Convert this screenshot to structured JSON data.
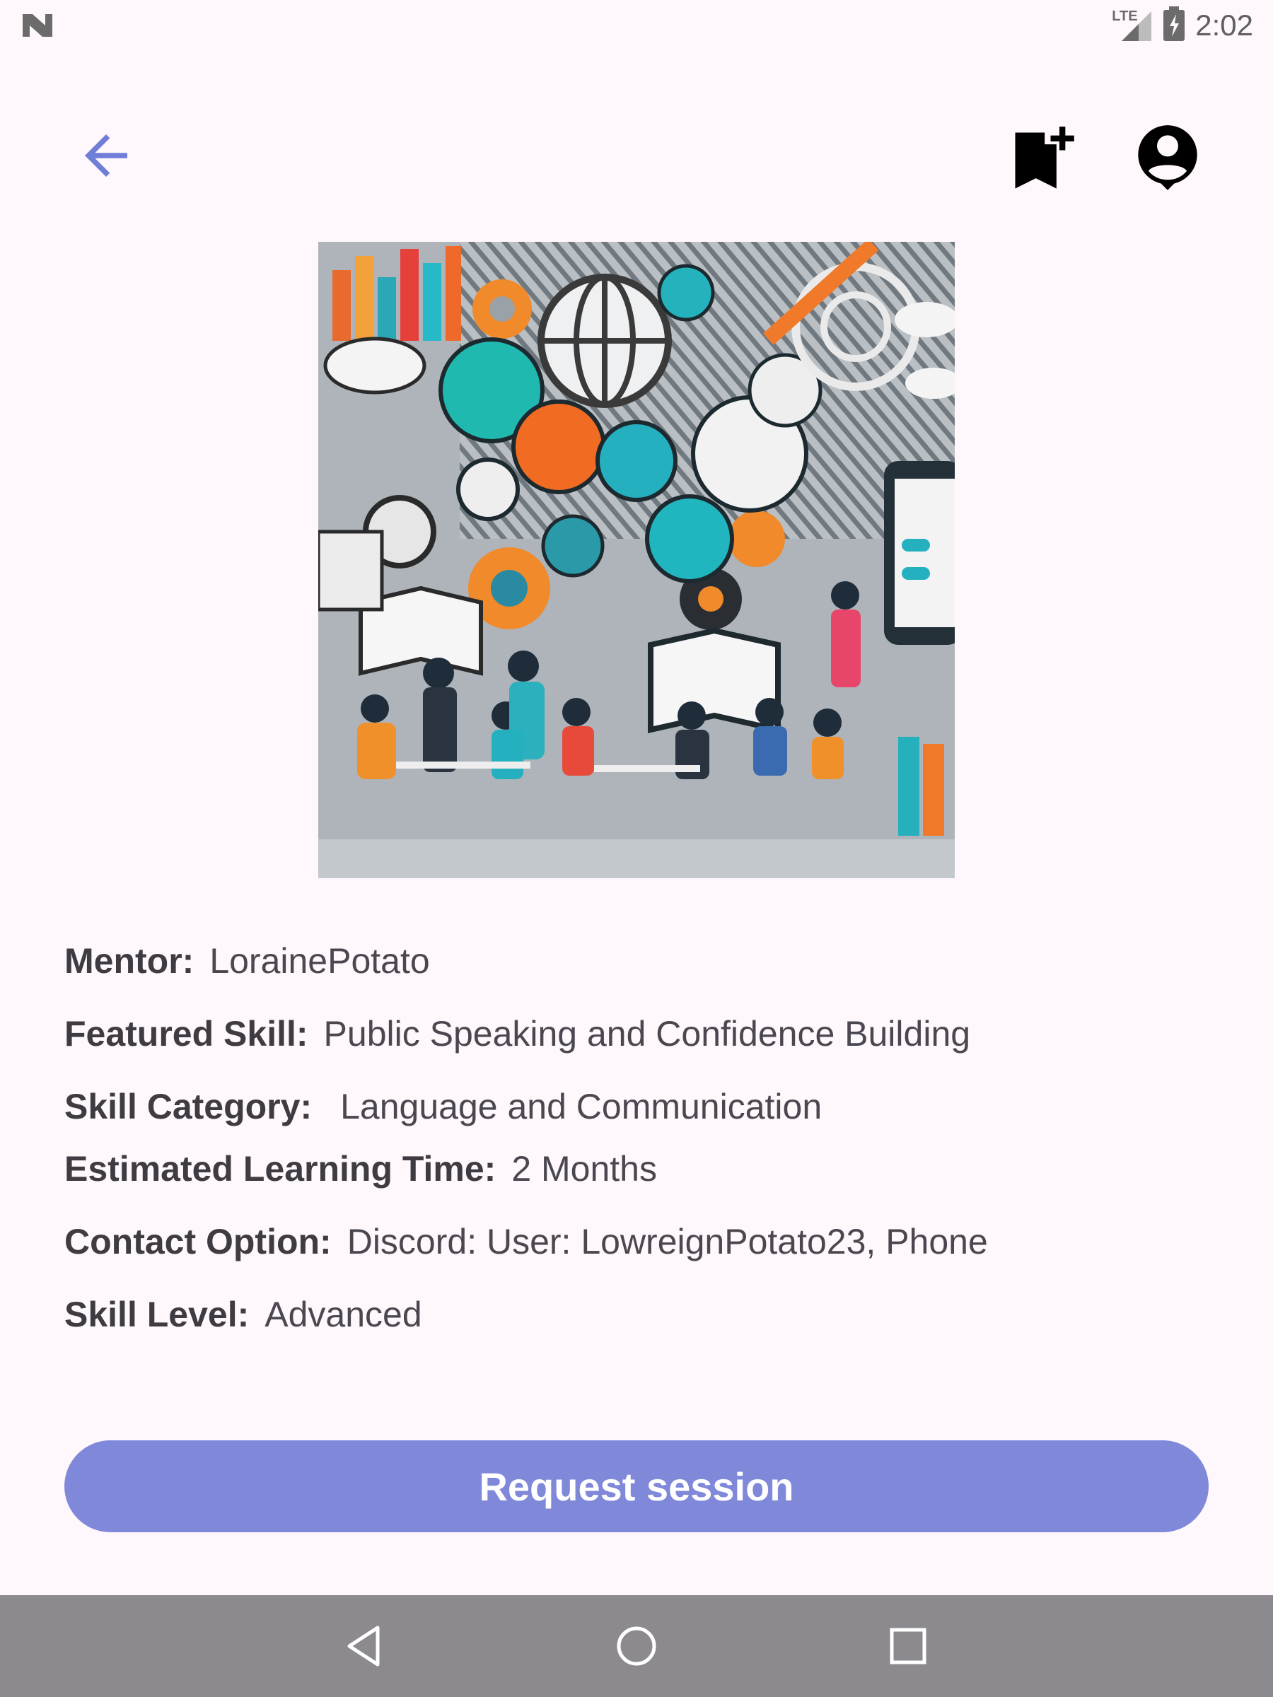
{
  "status_bar": {
    "time": "2:02",
    "network_label": "LTE",
    "icons": [
      "notification-n-icon",
      "signal-icon",
      "battery-charging-icon"
    ]
  },
  "top_bar": {
    "icons": [
      "arrow-back-icon",
      "bookmark-add-icon",
      "account-circle-icon"
    ],
    "accent_color": "#6f7ed6"
  },
  "hero_image": {
    "description_icon": "skill-illustration-image"
  },
  "details": {
    "mentor": {
      "label": "Mentor:",
      "value": "LorainePotato"
    },
    "featured_skill": {
      "label": "Featured Skill:",
      "value": "Public Speaking and Confidence Building"
    },
    "skill_category": {
      "label": "Skill Category:",
      "value": "Language and Communication"
    },
    "learning_time": {
      "label": "Estimated Learning Time:",
      "value": "2 Months"
    },
    "contact_option": {
      "label": "Contact Option:",
      "value": "Discord: User: LowreignPotato23, Phone"
    },
    "skill_level": {
      "label": "Skill Level:",
      "value": "Advanced"
    }
  },
  "actions": {
    "request_label": "Request session",
    "button_color": "#8088da"
  },
  "nav_bar": {
    "icons": [
      "nav-back-icon",
      "nav-home-icon",
      "nav-recents-icon"
    ]
  }
}
